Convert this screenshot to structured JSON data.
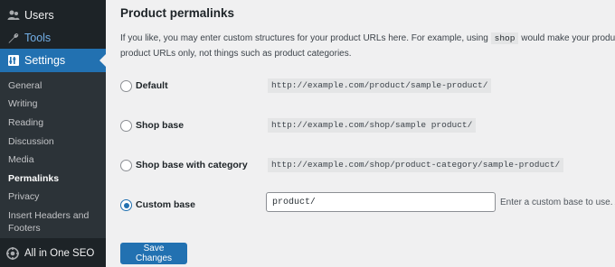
{
  "sidebar": {
    "users_label": "Users",
    "tools_label": "Tools",
    "settings_label": "Settings",
    "submenu": [
      {
        "label": "General"
      },
      {
        "label": "Writing"
      },
      {
        "label": "Reading"
      },
      {
        "label": "Discussion"
      },
      {
        "label": "Media"
      },
      {
        "label": "Permalinks",
        "current": true
      },
      {
        "label": "Privacy"
      },
      {
        "label": "Insert Headers and"
      },
      {
        "label": "Footers"
      }
    ],
    "aioseo_label": "All in One SEO"
  },
  "section": {
    "title": "Product permalinks",
    "description_prefix": "If you like, you may enter custom structures for your product URLs here. For example, using ",
    "description_code": "shop",
    "description_suffix": " would make your product links",
    "description_line2": "product URLs only, not things such as product categories."
  },
  "options": [
    {
      "label": "Default",
      "example": "http://example.com/product/sample-product/",
      "checked": false
    },
    {
      "label": "Shop base",
      "example": "http://example.com/shop/sample product/",
      "checked": false
    },
    {
      "label": "Shop base with category",
      "example": "http://example.com/shop/product-category/sample-product/",
      "checked": false
    },
    {
      "label": "Custom base",
      "checked": true
    }
  ],
  "custom_base": {
    "value": "product/",
    "help_text": "Enter a custom base to use. A"
  },
  "save_button_label": "Save Changes",
  "colors": {
    "sidebar_bg": "#1d2327",
    "submenu_bg": "#2c3338",
    "accent": "#2271b1",
    "tools_link": "#72aee6",
    "page_bg": "#f0f0f1"
  }
}
